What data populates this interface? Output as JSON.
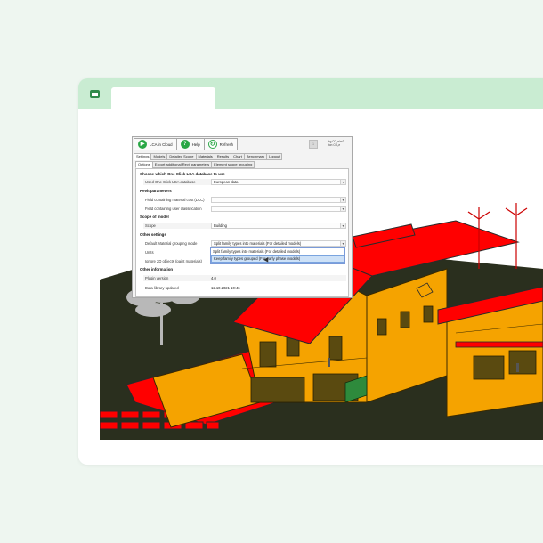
{
  "window": {
    "tab_label": ""
  },
  "plugin": {
    "toolbar": {
      "lca_cloud": "LCA in Cloud",
      "help": "Help",
      "refresh": "Refresh",
      "icon_play": "play-icon",
      "icon_help": "help-icon",
      "icon_refresh": "refresh-icon"
    },
    "side_info": {
      "line1": "kg CO₂e/m2",
      "line2": "ton CO₂e"
    },
    "main_tabs": [
      "Settings",
      "Models",
      "Detailed Scope",
      "Materials",
      "Results",
      "Chart",
      "Benchmark",
      "Logout"
    ],
    "sub_tabs": [
      "Options",
      "Export additional Revit parameters",
      "Element scope grouping"
    ],
    "sections": {
      "db": "Choose which One Click LCA database to use",
      "revit": "Revit parameters",
      "scope": "Scope of model",
      "other": "Other settings",
      "info": "Other information"
    },
    "rows": {
      "db_label": "Used One Click LCA database",
      "db_value": "European data",
      "cost_label": "Field containing material cost (LCC)",
      "class_label": "Field containing user classification",
      "scope_label": "Scope",
      "scope_value": "Building",
      "grouping_label": "Default Material grouping mode",
      "grouping_value": "Split family types into materials (For detailed models)",
      "units_label": "Units",
      "ignore_label": "Ignore 2D objects (paint materials)",
      "version_label": "Plugin version",
      "version_value": "4.0",
      "updated_label": "Data library updated",
      "updated_value": "12.10.2021 10:46"
    },
    "dropdown_options": [
      "Split family types into materials (For detailed models)",
      "Keep family types grouped (For early phase models)"
    ],
    "dropdown_selected_index": 1
  },
  "colors": {
    "background": "#eef6f0",
    "titlebar": "#c9ecd2",
    "accent": "#29a745",
    "roof_red": "#ff0000",
    "wall_orange": "#f5a300",
    "ground": "#2a2f1e"
  }
}
